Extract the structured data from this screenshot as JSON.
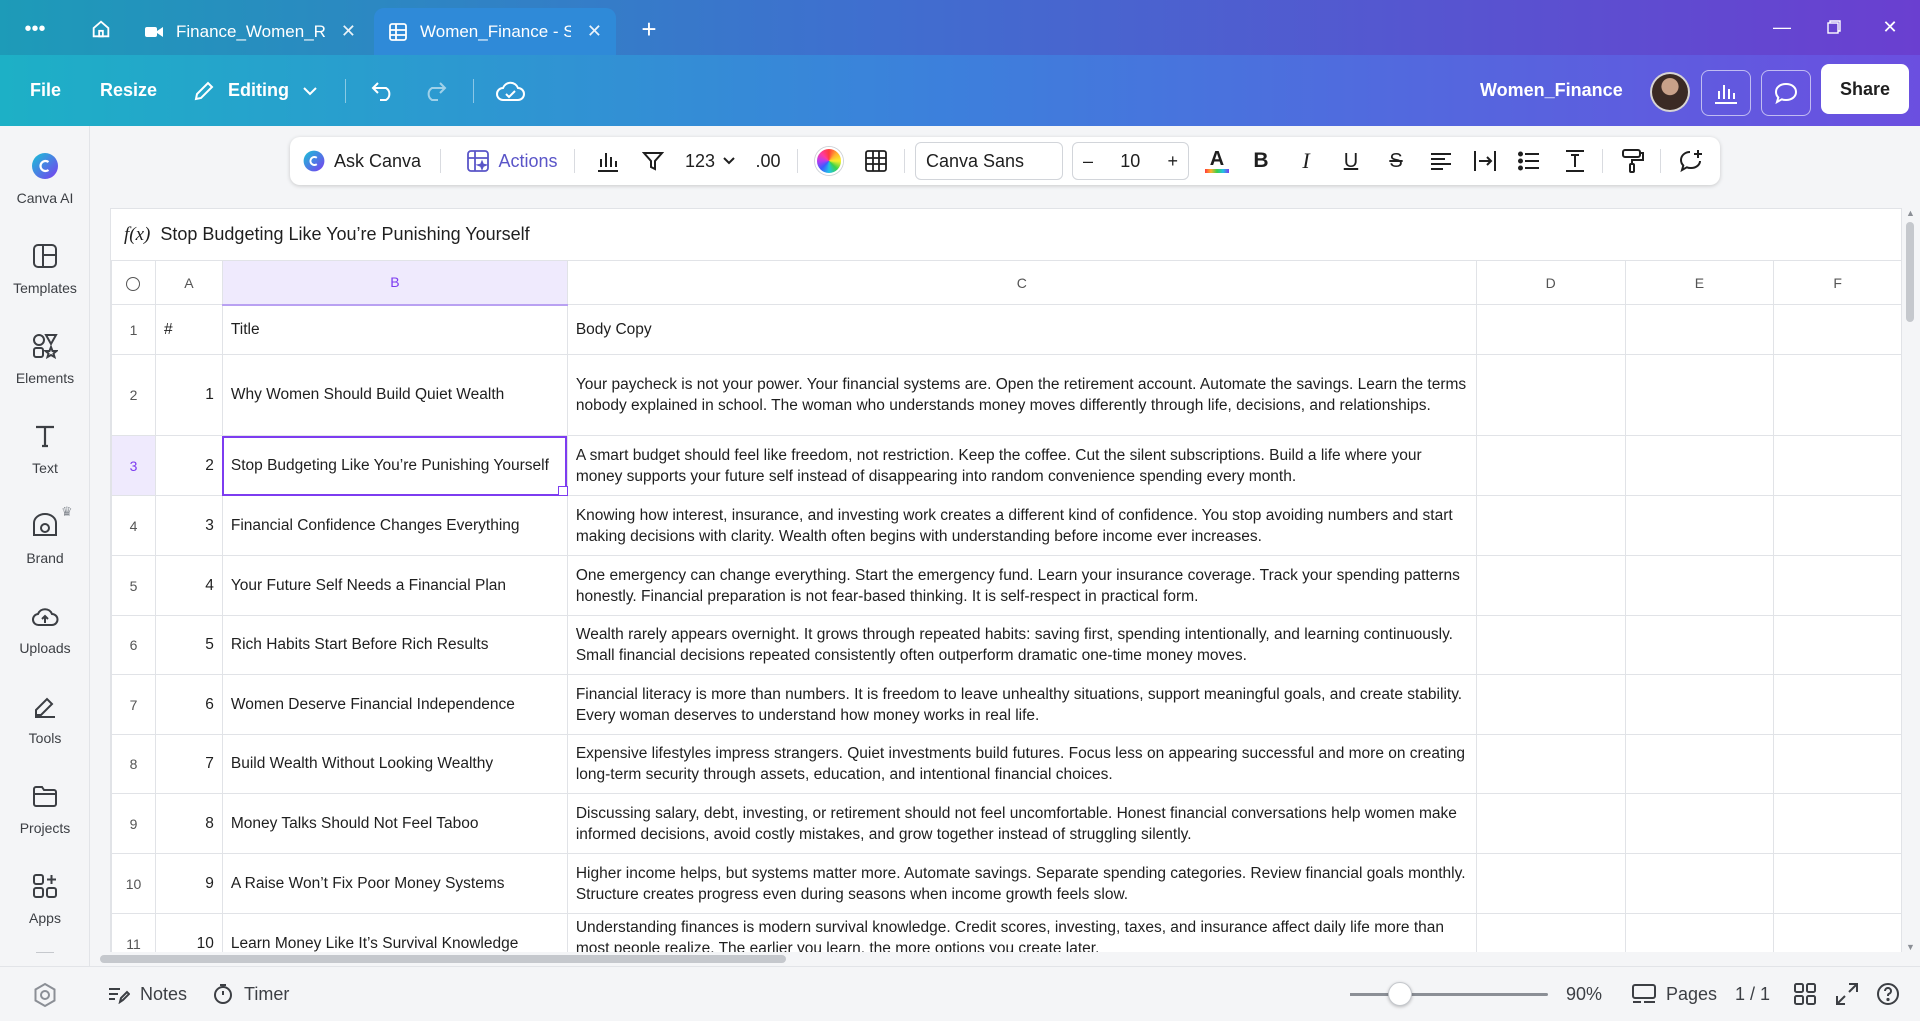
{
  "browser": {
    "tabs": [
      {
        "label": "Finance_Women_R...",
        "icon": "video-icon",
        "active": false
      },
      {
        "label": "Women_Finance - S...",
        "icon": "sheet-icon",
        "active": true
      }
    ]
  },
  "appbar": {
    "file": "File",
    "resize": "Resize",
    "editing": "Editing",
    "doc_title": "Women_Finance",
    "share": "Share"
  },
  "rail": {
    "items": [
      {
        "label": "Canva AI",
        "icon": "canva-ai-icon"
      },
      {
        "label": "Templates",
        "icon": "templates-icon"
      },
      {
        "label": "Elements",
        "icon": "elements-icon"
      },
      {
        "label": "Text",
        "icon": "text-icon"
      },
      {
        "label": "Brand",
        "icon": "brand-icon"
      },
      {
        "label": "Uploads",
        "icon": "uploads-icon"
      },
      {
        "label": "Tools",
        "icon": "tools-icon"
      },
      {
        "label": "Projects",
        "icon": "projects-icon"
      },
      {
        "label": "Apps",
        "icon": "apps-icon"
      }
    ]
  },
  "toolbar": {
    "ask_canva": "Ask Canva",
    "actions": "Actions",
    "number_format": "123",
    "decimals": ".00",
    "font": "Canva Sans",
    "minus": "–",
    "size": "10",
    "plus": "+",
    "accent_color": "#7d3cf0"
  },
  "formula": {
    "fx": "f(x)",
    "value": "Stop Budgeting Like You’re Punishing Yourself"
  },
  "grid": {
    "corner": "",
    "columns": [
      "A",
      "B",
      "C",
      "D",
      "E",
      "F"
    ],
    "rows": [
      {
        "n": "1",
        "a": "#",
        "b": "Title",
        "c": "Body Copy"
      },
      {
        "n": "2",
        "a": "1",
        "b": "Why Women Should Build Quiet Wealth",
        "c": "Your paycheck is not your power. Your financial systems are. Open the retirement account. Automate the savings. Learn the terms nobody explained in school. The woman who understands money moves differently through life, decisions, and relationships."
      },
      {
        "n": "3",
        "a": "2",
        "b": "Stop Budgeting Like You’re Punishing Yourself",
        "c": "A smart budget should feel like freedom, not restriction. Keep the coffee. Cut the silent subscriptions. Build a life where your money supports your future self instead of disappearing into random convenience spending every month."
      },
      {
        "n": "4",
        "a": "3",
        "b": "Financial Confidence Changes Everything",
        "c": "Knowing how interest, insurance, and investing work creates a different kind of confidence. You stop avoiding numbers and start making decisions with clarity. Wealth often begins with understanding before income ever increases."
      },
      {
        "n": "5",
        "a": "4",
        "b": "Your Future Self Needs a Financial Plan",
        "c": "One emergency can change everything. Start the emergency fund. Learn your insurance coverage. Track your spending patterns honestly. Financial preparation is not fear-based thinking. It is self-respect in practical form."
      },
      {
        "n": "6",
        "a": "5",
        "b": "Rich Habits Start Before Rich Results",
        "c": "Wealth rarely appears overnight. It grows through repeated habits: saving first, spending intentionally, and learning continuously. Small financial decisions repeated consistently often outperform dramatic one-time money moves."
      },
      {
        "n": "7",
        "a": "6",
        "b": "Women Deserve Financial Independence",
        "c": "Financial literacy is more than numbers. It is freedom to leave unhealthy situations, support meaningful goals, and create stability. Every woman deserves to understand how money works in real life."
      },
      {
        "n": "8",
        "a": "7",
        "b": "Build Wealth Without Looking Wealthy",
        "c": "Expensive lifestyles impress strangers. Quiet investments build futures. Focus less on appearing successful and more on creating long-term security through assets, education, and intentional financial choices."
      },
      {
        "n": "9",
        "a": "8",
        "b": "Money Talks Should Not Feel Taboo",
        "c": "Discussing salary, debt, investing, or retirement should not feel uncomfortable. Honest financial conversations help women make informed decisions, avoid costly mistakes, and grow together instead of struggling silently."
      },
      {
        "n": "10",
        "a": "9",
        "b": "A Raise Won’t Fix Poor Money Systems",
        "c": "Higher income helps, but systems matter more. Automate savings. Separate spending categories. Review financial goals monthly. Structure creates progress even during seasons when income growth feels slow."
      },
      {
        "n": "11",
        "a": "10",
        "b": "Learn Money Like It’s Survival Knowledge",
        "c": "Understanding finances is modern survival knowledge. Credit scores, investing, taxes, and insurance affect daily life more than most people realize. The earlier you learn, the more options you create later."
      }
    ]
  },
  "footer": {
    "notes": "Notes",
    "timer": "Timer",
    "zoom": "90%",
    "zoom_fraction": 0.25,
    "pages": "Pages",
    "page_count": "1 / 1"
  }
}
